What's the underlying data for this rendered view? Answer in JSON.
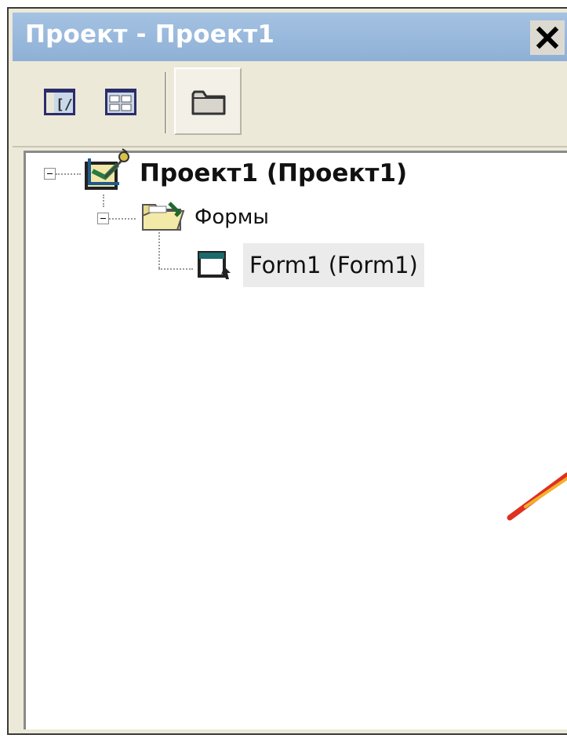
{
  "window": {
    "title": "Проект - Проект1",
    "close_label": "×"
  },
  "toolbar": {
    "buttons": [
      {
        "name": "view-code",
        "icon": "view-code-icon"
      },
      {
        "name": "view-object",
        "icon": "view-object-icon"
      },
      {
        "name": "toggle-folders",
        "icon": "folder-icon",
        "pressed": true
      }
    ]
  },
  "tree": {
    "root": {
      "label": "Проект1 (Проект1)",
      "icon": "project-icon",
      "expanded": true
    },
    "folder": {
      "label": "Формы",
      "icon": "folder-open-icon",
      "expanded": true
    },
    "form": {
      "label": "Form1 (Form1)",
      "icon": "form-icon",
      "selected": true
    }
  },
  "colors": {
    "titlebar": "#93b5d9",
    "frame": "#ece9d8",
    "selection": "#ebebeb",
    "arrow": "#e03020"
  }
}
